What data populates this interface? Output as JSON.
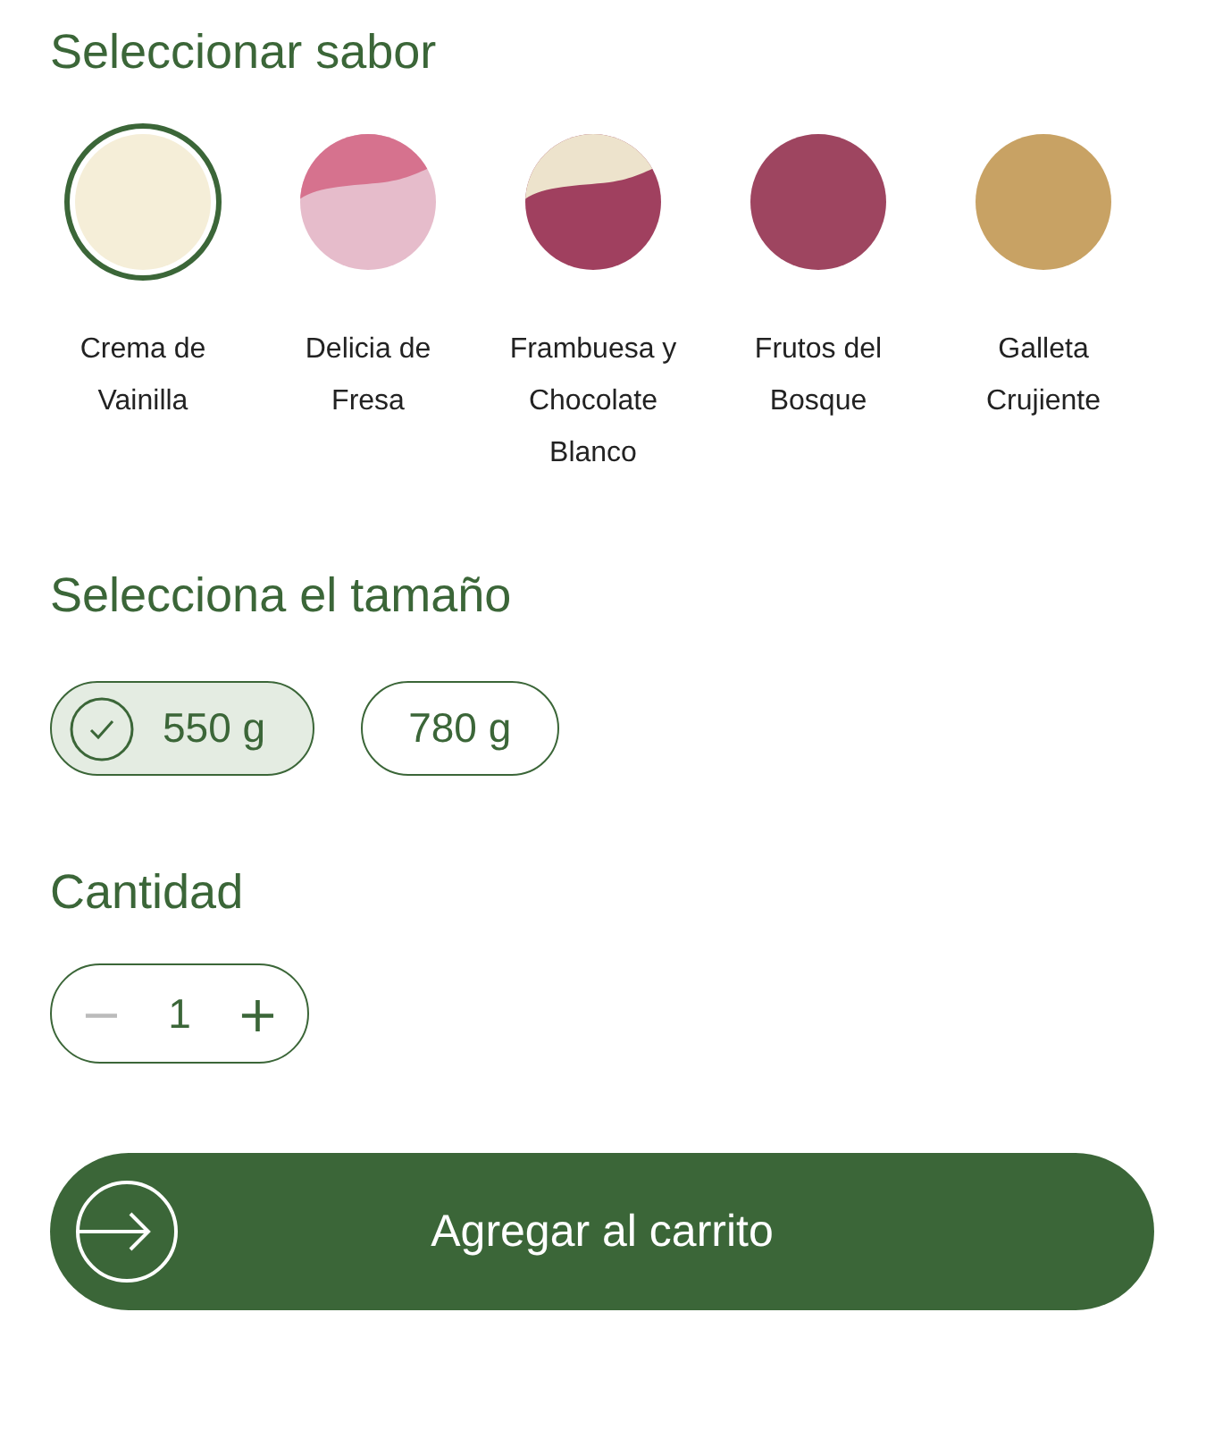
{
  "flavor_section": {
    "title": "Seleccionar sabor",
    "flavors": [
      {
        "label": "Crema de Vainilla",
        "kind": "solid",
        "color": "#f5eed8",
        "selected": true
      },
      {
        "label": "Delicia de Fresa",
        "kind": "split",
        "color": "#e6bccb",
        "top": {
          "color": "#d6728e"
        },
        "selected": false
      },
      {
        "label": "Frambuesa y Chocolate Blanco",
        "kind": "split",
        "color": "#a0405f",
        "top": {
          "color": "#ede3cc"
        },
        "selected": false
      },
      {
        "label": "Frutos del Bosque",
        "kind": "solid",
        "color": "#9e4560",
        "selected": false
      },
      {
        "label": "Galleta Crujiente",
        "kind": "solid",
        "color": "#c8a264",
        "selected": false
      }
    ]
  },
  "size_section": {
    "title": "Selecciona el tamaño",
    "sizes": [
      {
        "label": "550 g",
        "selected": true
      },
      {
        "label": "780 g",
        "selected": false
      }
    ]
  },
  "quantity_section": {
    "title": "Cantidad",
    "minus": "−",
    "value": "1",
    "plus": "+",
    "minus_disabled": true
  },
  "add_to_cart": {
    "label": "Agregar al carrito"
  }
}
